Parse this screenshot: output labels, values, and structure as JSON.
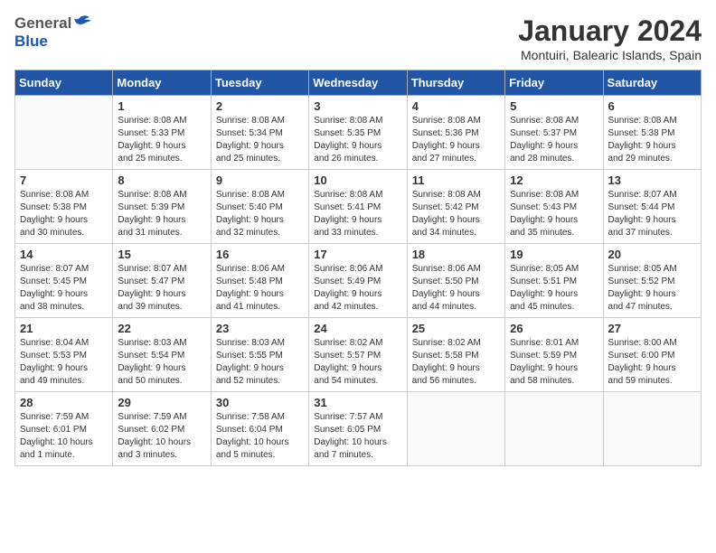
{
  "logo": {
    "general": "General",
    "blue": "Blue"
  },
  "title": "January 2024",
  "subtitle": "Montuiri, Balearic Islands, Spain",
  "days_of_week": [
    "Sunday",
    "Monday",
    "Tuesday",
    "Wednesday",
    "Thursday",
    "Friday",
    "Saturday"
  ],
  "weeks": [
    [
      {
        "day": "",
        "info": ""
      },
      {
        "day": "1",
        "info": "Sunrise: 8:08 AM\nSunset: 5:33 PM\nDaylight: 9 hours\nand 25 minutes."
      },
      {
        "day": "2",
        "info": "Sunrise: 8:08 AM\nSunset: 5:34 PM\nDaylight: 9 hours\nand 25 minutes."
      },
      {
        "day": "3",
        "info": "Sunrise: 8:08 AM\nSunset: 5:35 PM\nDaylight: 9 hours\nand 26 minutes."
      },
      {
        "day": "4",
        "info": "Sunrise: 8:08 AM\nSunset: 5:36 PM\nDaylight: 9 hours\nand 27 minutes."
      },
      {
        "day": "5",
        "info": "Sunrise: 8:08 AM\nSunset: 5:37 PM\nDaylight: 9 hours\nand 28 minutes."
      },
      {
        "day": "6",
        "info": "Sunrise: 8:08 AM\nSunset: 5:38 PM\nDaylight: 9 hours\nand 29 minutes."
      }
    ],
    [
      {
        "day": "7",
        "info": "Sunrise: 8:08 AM\nSunset: 5:38 PM\nDaylight: 9 hours\nand 30 minutes."
      },
      {
        "day": "8",
        "info": "Sunrise: 8:08 AM\nSunset: 5:39 PM\nDaylight: 9 hours\nand 31 minutes."
      },
      {
        "day": "9",
        "info": "Sunrise: 8:08 AM\nSunset: 5:40 PM\nDaylight: 9 hours\nand 32 minutes."
      },
      {
        "day": "10",
        "info": "Sunrise: 8:08 AM\nSunset: 5:41 PM\nDaylight: 9 hours\nand 33 minutes."
      },
      {
        "day": "11",
        "info": "Sunrise: 8:08 AM\nSunset: 5:42 PM\nDaylight: 9 hours\nand 34 minutes."
      },
      {
        "day": "12",
        "info": "Sunrise: 8:08 AM\nSunset: 5:43 PM\nDaylight: 9 hours\nand 35 minutes."
      },
      {
        "day": "13",
        "info": "Sunrise: 8:07 AM\nSunset: 5:44 PM\nDaylight: 9 hours\nand 37 minutes."
      }
    ],
    [
      {
        "day": "14",
        "info": "Sunrise: 8:07 AM\nSunset: 5:45 PM\nDaylight: 9 hours\nand 38 minutes."
      },
      {
        "day": "15",
        "info": "Sunrise: 8:07 AM\nSunset: 5:47 PM\nDaylight: 9 hours\nand 39 minutes."
      },
      {
        "day": "16",
        "info": "Sunrise: 8:06 AM\nSunset: 5:48 PM\nDaylight: 9 hours\nand 41 minutes."
      },
      {
        "day": "17",
        "info": "Sunrise: 8:06 AM\nSunset: 5:49 PM\nDaylight: 9 hours\nand 42 minutes."
      },
      {
        "day": "18",
        "info": "Sunrise: 8:06 AM\nSunset: 5:50 PM\nDaylight: 9 hours\nand 44 minutes."
      },
      {
        "day": "19",
        "info": "Sunrise: 8:05 AM\nSunset: 5:51 PM\nDaylight: 9 hours\nand 45 minutes."
      },
      {
        "day": "20",
        "info": "Sunrise: 8:05 AM\nSunset: 5:52 PM\nDaylight: 9 hours\nand 47 minutes."
      }
    ],
    [
      {
        "day": "21",
        "info": "Sunrise: 8:04 AM\nSunset: 5:53 PM\nDaylight: 9 hours\nand 49 minutes."
      },
      {
        "day": "22",
        "info": "Sunrise: 8:03 AM\nSunset: 5:54 PM\nDaylight: 9 hours\nand 50 minutes."
      },
      {
        "day": "23",
        "info": "Sunrise: 8:03 AM\nSunset: 5:55 PM\nDaylight: 9 hours\nand 52 minutes."
      },
      {
        "day": "24",
        "info": "Sunrise: 8:02 AM\nSunset: 5:57 PM\nDaylight: 9 hours\nand 54 minutes."
      },
      {
        "day": "25",
        "info": "Sunrise: 8:02 AM\nSunset: 5:58 PM\nDaylight: 9 hours\nand 56 minutes."
      },
      {
        "day": "26",
        "info": "Sunrise: 8:01 AM\nSunset: 5:59 PM\nDaylight: 9 hours\nand 58 minutes."
      },
      {
        "day": "27",
        "info": "Sunrise: 8:00 AM\nSunset: 6:00 PM\nDaylight: 9 hours\nand 59 minutes."
      }
    ],
    [
      {
        "day": "28",
        "info": "Sunrise: 7:59 AM\nSunset: 6:01 PM\nDaylight: 10 hours\nand 1 minute."
      },
      {
        "day": "29",
        "info": "Sunrise: 7:59 AM\nSunset: 6:02 PM\nDaylight: 10 hours\nand 3 minutes."
      },
      {
        "day": "30",
        "info": "Sunrise: 7:58 AM\nSunset: 6:04 PM\nDaylight: 10 hours\nand 5 minutes."
      },
      {
        "day": "31",
        "info": "Sunrise: 7:57 AM\nSunset: 6:05 PM\nDaylight: 10 hours\nand 7 minutes."
      },
      {
        "day": "",
        "info": ""
      },
      {
        "day": "",
        "info": ""
      },
      {
        "day": "",
        "info": ""
      }
    ]
  ]
}
